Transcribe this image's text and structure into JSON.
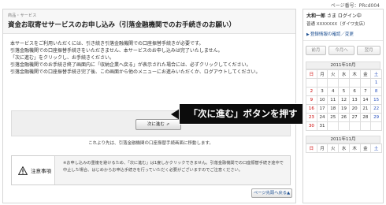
{
  "page_number": "ページ番号：PRcd004",
  "main": {
    "category": "商品・サービス",
    "title": "資金お取寄せサービスのお申し込み（引落金融機関でのお手続きのお願い）",
    "paragraphs": [
      "本サービスをご利用いただくには、引き続き引落金融機関での口座振替手続きが必要です。",
      "引落金融機関での口座振替手続きをいただきません、本サービスのお申し込みは完了いたしません。",
      "「次に進む」をクリックし、お手続きください。",
      "引落金融機関でのお手続き終了画面内に「収納企業へ戻る」が表示された場合には、必ずクリックしてください。",
      "引落金融機関での口座振替手続き完了後、この画面から他のメニューにお進みいただくか、ログアウトしてください。"
    ],
    "next_button_label": "次に進む",
    "next_button_arrow": "⇗",
    "note_line": "これより先は、引落金融機関の口座振替手続画面に移動します。",
    "caution_label": "注意事項",
    "caution_text": "※お申し込みの重複を避けるため、「次に進む」は1度しかクリックできません。引落金融機関での口座振替手続き途中で中止した場合、はじめからお申込手続きを行っていただく必要がございますのでご注意ください。",
    "back_button_label": "ページ先頭へ戻る",
    "back_button_arrow": "▲"
  },
  "callout": {
    "text": "「次に進む」ボタンを押す"
  },
  "sidebar": {
    "user_name": "大和一郎",
    "user_suffix": "さま ログイン中",
    "account_line": "普通 XXXXXXX（ダイワ支店）",
    "registration_link": "登録情報の確認／変更",
    "nav_prev": "前月",
    "nav_current": "今月へ",
    "nav_next": "翌月",
    "calendar_oct": "2011年10月",
    "calendar_nov": "2011年11月",
    "weekdays": [
      "日",
      "月",
      "火",
      "水",
      "木",
      "金",
      "土"
    ],
    "oct_rows": [
      [
        "",
        "",
        "",
        "",
        "",
        "",
        "1"
      ],
      [
        "2",
        "3",
        "4",
        "5",
        "6",
        "7",
        "8"
      ],
      [
        "9",
        "10",
        "11",
        "12",
        "13",
        "14",
        "15"
      ],
      [
        "16",
        "17",
        "18",
        "19",
        "20",
        "21",
        "22"
      ],
      [
        "23",
        "24",
        "25",
        "26",
        "27",
        "28",
        "29"
      ],
      [
        "30",
        "31",
        "",
        "",
        "",
        "",
        ""
      ]
    ]
  },
  "colors": {
    "accent_blue": "#1d4f91",
    "sunday_red": "#cc0000",
    "callout_bg": "#0c0c0c"
  }
}
